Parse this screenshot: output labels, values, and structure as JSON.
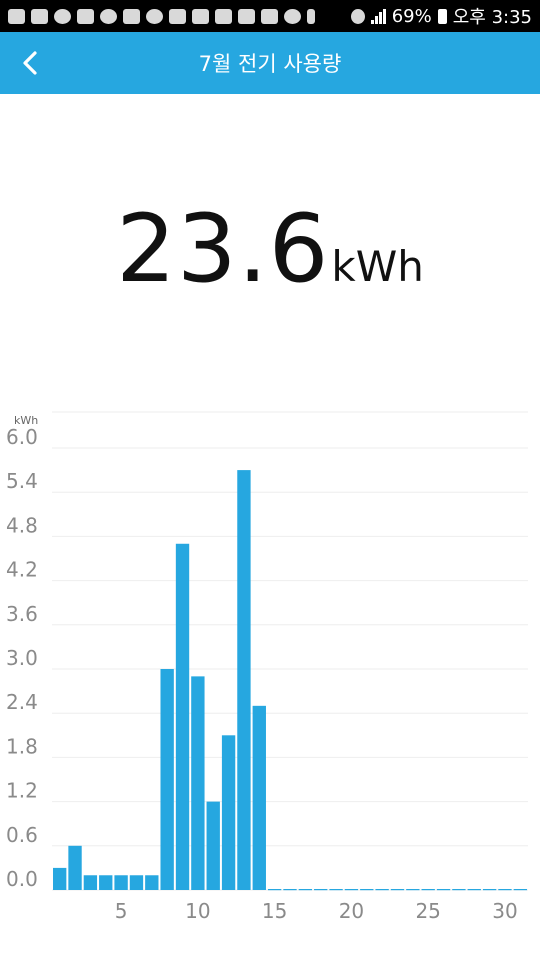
{
  "status_bar": {
    "battery": "69%",
    "time": "오후 3:35",
    "icons": [
      "bbm-icon",
      "facebook-icon",
      "fitness-icon",
      "facebook-icon",
      "wechat-icon",
      "phone-icon",
      "cloud-icon",
      "mail-icon",
      "image-icon",
      "image-icon",
      "sbs-icon",
      "image-icon",
      "talk-icon",
      "bluetooth-icon",
      "wifi-icon",
      "signal-icon",
      "battery-icon"
    ]
  },
  "header": {
    "back_icon": "chevron-left-icon",
    "title": "7월 전기 사용량",
    "color": "#26a7e0"
  },
  "summary": {
    "value": "23.6",
    "unit": "kWh"
  },
  "chart_data": {
    "type": "bar",
    "unit_label": "kWh",
    "x": [
      1,
      2,
      3,
      4,
      5,
      6,
      7,
      8,
      9,
      10,
      11,
      12,
      13,
      14,
      15,
      16,
      17,
      18,
      19,
      20,
      21,
      22,
      23,
      24,
      25,
      26,
      27,
      28,
      29,
      30,
      31
    ],
    "values": [
      0.3,
      0.6,
      0.2,
      0.2,
      0.2,
      0.2,
      0.2,
      3.0,
      4.7,
      2.9,
      1.2,
      2.1,
      5.7,
      2.5,
      0,
      0,
      0,
      0,
      0,
      0,
      0,
      0,
      0,
      0,
      0,
      0,
      0,
      0,
      0,
      0,
      0
    ],
    "ylim": [
      0,
      6.0
    ],
    "yticks": [
      0.0,
      0.6,
      1.2,
      1.8,
      2.4,
      3.0,
      3.6,
      4.2,
      4.8,
      5.4,
      6.0
    ],
    "ytick_labels": [
      "0.0",
      "0.6",
      "1.2",
      "1.8",
      "2.4",
      "3.0",
      "3.6",
      "4.2",
      "4.8",
      "5.4",
      "6.0"
    ],
    "xticks": [
      5,
      10,
      15,
      20,
      25,
      30
    ],
    "xtick_labels": [
      "5",
      "10",
      "15",
      "20",
      "25",
      "30"
    ],
    "bar_color": "#26a7e0",
    "grid": true
  }
}
